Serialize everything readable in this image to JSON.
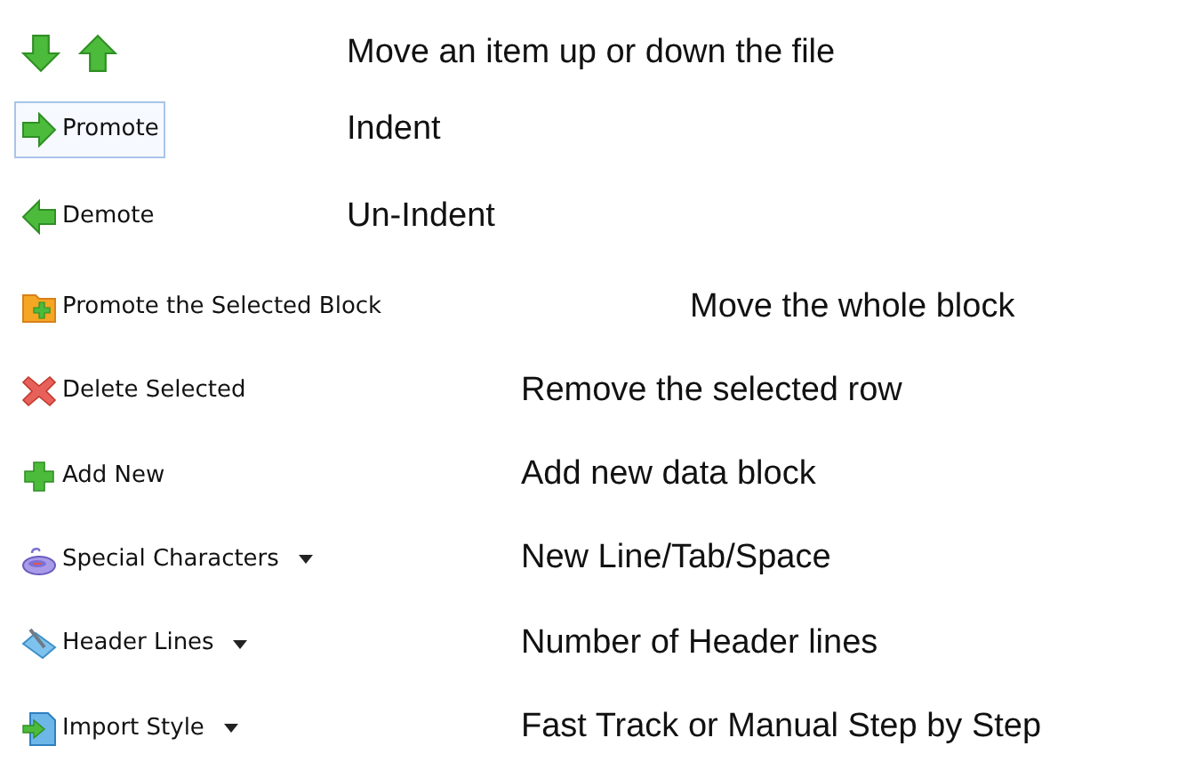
{
  "rows": [
    {
      "kind": "arrows",
      "description": "Move an item up or down the file"
    },
    {
      "kind": "button",
      "label": "Promote",
      "highlighted": true,
      "dropdown": false,
      "description": "Indent"
    },
    {
      "kind": "button",
      "label": "Demote",
      "highlighted": false,
      "dropdown": false,
      "description": "Un-Indent"
    },
    {
      "kind": "button",
      "label": "Promote the Selected Block",
      "highlighted": false,
      "dropdown": false,
      "description": "Move the whole block"
    },
    {
      "kind": "button",
      "label": "Delete Selected",
      "highlighted": false,
      "dropdown": false,
      "description": "Remove the selected row"
    },
    {
      "kind": "button",
      "label": "Add New",
      "highlighted": false,
      "dropdown": false,
      "description": "Add new data block"
    },
    {
      "kind": "button",
      "label": "Special Characters",
      "highlighted": false,
      "dropdown": true,
      "description": "New Line/Tab/Space"
    },
    {
      "kind": "button",
      "label": "Header Lines",
      "highlighted": false,
      "dropdown": true,
      "description": "Number of Header lines"
    },
    {
      "kind": "button",
      "label": "Import Style",
      "highlighted": false,
      "dropdown": true,
      "description": "Fast Track or Manual Step by Step"
    }
  ]
}
